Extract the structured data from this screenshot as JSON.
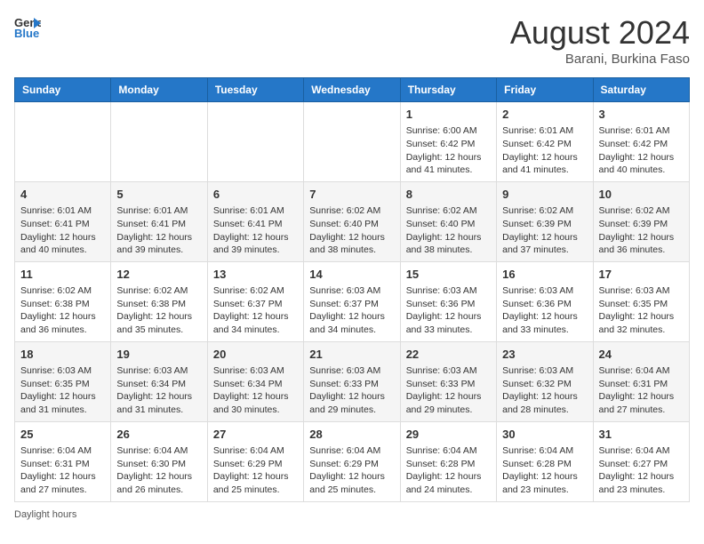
{
  "header": {
    "logo_line1": "General",
    "logo_line2": "Blue",
    "month_year": "August 2024",
    "location": "Barani, Burkina Faso"
  },
  "days_of_week": [
    "Sunday",
    "Monday",
    "Tuesday",
    "Wednesday",
    "Thursday",
    "Friday",
    "Saturday"
  ],
  "weeks": [
    [
      {
        "day": "",
        "content": ""
      },
      {
        "day": "",
        "content": ""
      },
      {
        "day": "",
        "content": ""
      },
      {
        "day": "",
        "content": ""
      },
      {
        "day": "1",
        "content": "Sunrise: 6:00 AM\nSunset: 6:42 PM\nDaylight: 12 hours\nand 41 minutes."
      },
      {
        "day": "2",
        "content": "Sunrise: 6:01 AM\nSunset: 6:42 PM\nDaylight: 12 hours\nand 41 minutes."
      },
      {
        "day": "3",
        "content": "Sunrise: 6:01 AM\nSunset: 6:42 PM\nDaylight: 12 hours\nand 40 minutes."
      }
    ],
    [
      {
        "day": "4",
        "content": "Sunrise: 6:01 AM\nSunset: 6:41 PM\nDaylight: 12 hours\nand 40 minutes."
      },
      {
        "day": "5",
        "content": "Sunrise: 6:01 AM\nSunset: 6:41 PM\nDaylight: 12 hours\nand 39 minutes."
      },
      {
        "day": "6",
        "content": "Sunrise: 6:01 AM\nSunset: 6:41 PM\nDaylight: 12 hours\nand 39 minutes."
      },
      {
        "day": "7",
        "content": "Sunrise: 6:02 AM\nSunset: 6:40 PM\nDaylight: 12 hours\nand 38 minutes."
      },
      {
        "day": "8",
        "content": "Sunrise: 6:02 AM\nSunset: 6:40 PM\nDaylight: 12 hours\nand 38 minutes."
      },
      {
        "day": "9",
        "content": "Sunrise: 6:02 AM\nSunset: 6:39 PM\nDaylight: 12 hours\nand 37 minutes."
      },
      {
        "day": "10",
        "content": "Sunrise: 6:02 AM\nSunset: 6:39 PM\nDaylight: 12 hours\nand 36 minutes."
      }
    ],
    [
      {
        "day": "11",
        "content": "Sunrise: 6:02 AM\nSunset: 6:38 PM\nDaylight: 12 hours\nand 36 minutes."
      },
      {
        "day": "12",
        "content": "Sunrise: 6:02 AM\nSunset: 6:38 PM\nDaylight: 12 hours\nand 35 minutes."
      },
      {
        "day": "13",
        "content": "Sunrise: 6:02 AM\nSunset: 6:37 PM\nDaylight: 12 hours\nand 34 minutes."
      },
      {
        "day": "14",
        "content": "Sunrise: 6:03 AM\nSunset: 6:37 PM\nDaylight: 12 hours\nand 34 minutes."
      },
      {
        "day": "15",
        "content": "Sunrise: 6:03 AM\nSunset: 6:36 PM\nDaylight: 12 hours\nand 33 minutes."
      },
      {
        "day": "16",
        "content": "Sunrise: 6:03 AM\nSunset: 6:36 PM\nDaylight: 12 hours\nand 33 minutes."
      },
      {
        "day": "17",
        "content": "Sunrise: 6:03 AM\nSunset: 6:35 PM\nDaylight: 12 hours\nand 32 minutes."
      }
    ],
    [
      {
        "day": "18",
        "content": "Sunrise: 6:03 AM\nSunset: 6:35 PM\nDaylight: 12 hours\nand 31 minutes."
      },
      {
        "day": "19",
        "content": "Sunrise: 6:03 AM\nSunset: 6:34 PM\nDaylight: 12 hours\nand 31 minutes."
      },
      {
        "day": "20",
        "content": "Sunrise: 6:03 AM\nSunset: 6:34 PM\nDaylight: 12 hours\nand 30 minutes."
      },
      {
        "day": "21",
        "content": "Sunrise: 6:03 AM\nSunset: 6:33 PM\nDaylight: 12 hours\nand 29 minutes."
      },
      {
        "day": "22",
        "content": "Sunrise: 6:03 AM\nSunset: 6:33 PM\nDaylight: 12 hours\nand 29 minutes."
      },
      {
        "day": "23",
        "content": "Sunrise: 6:03 AM\nSunset: 6:32 PM\nDaylight: 12 hours\nand 28 minutes."
      },
      {
        "day": "24",
        "content": "Sunrise: 6:04 AM\nSunset: 6:31 PM\nDaylight: 12 hours\nand 27 minutes."
      }
    ],
    [
      {
        "day": "25",
        "content": "Sunrise: 6:04 AM\nSunset: 6:31 PM\nDaylight: 12 hours\nand 27 minutes."
      },
      {
        "day": "26",
        "content": "Sunrise: 6:04 AM\nSunset: 6:30 PM\nDaylight: 12 hours\nand 26 minutes."
      },
      {
        "day": "27",
        "content": "Sunrise: 6:04 AM\nSunset: 6:29 PM\nDaylight: 12 hours\nand 25 minutes."
      },
      {
        "day": "28",
        "content": "Sunrise: 6:04 AM\nSunset: 6:29 PM\nDaylight: 12 hours\nand 25 minutes."
      },
      {
        "day": "29",
        "content": "Sunrise: 6:04 AM\nSunset: 6:28 PM\nDaylight: 12 hours\nand 24 minutes."
      },
      {
        "day": "30",
        "content": "Sunrise: 6:04 AM\nSunset: 6:28 PM\nDaylight: 12 hours\nand 23 minutes."
      },
      {
        "day": "31",
        "content": "Sunrise: 6:04 AM\nSunset: 6:27 PM\nDaylight: 12 hours\nand 23 minutes."
      }
    ]
  ],
  "footer": {
    "daylight_label": "Daylight hours"
  }
}
